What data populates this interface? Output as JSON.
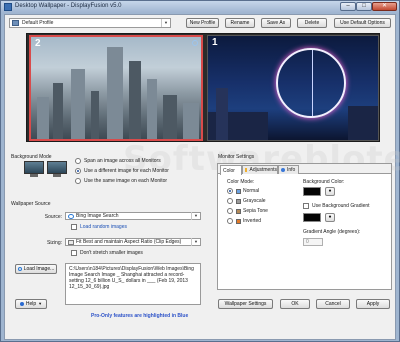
{
  "window": {
    "title": "Desktop Wallpaper - DisplayFusion v5.0"
  },
  "toolbar": {
    "profile_value": "Default Profile",
    "buttons": [
      "New Profile",
      "Rename",
      "Save As",
      "Delete",
      "Use Default Options"
    ]
  },
  "preview": {
    "monitor_numbers": [
      "2",
      "1"
    ]
  },
  "background_mode": {
    "heading": "Background Mode",
    "options": [
      {
        "label": "Span an image across all Monitors",
        "selected": false
      },
      {
        "label": "Use a different image for each Monitor",
        "selected": true
      },
      {
        "label": "Use the same image on each Monitor",
        "selected": false
      }
    ]
  },
  "wallpaper_source": {
    "heading": "Wallpaper Source",
    "source_label": "Source:",
    "source_value": "Bing Image Search",
    "load_random": "Load random images",
    "sizing_label": "Sizing:",
    "sizing_value": "Fit Best and maintain Aspect Ratio (Clip Edges)",
    "dont_stretch": "Don't stretch smaller images",
    "load_image_button": "Load Image...",
    "path_text": "C:\\Users\\n184\\Pictures\\DisplayFusion\\Web Images\\Bing Image Search Image _ Shanghai attracted a record-setting 12_6 billion U_S_ dollars in ___ (Feb 19, 2013 12_15_30_69).jpg"
  },
  "monitor_settings": {
    "heading": "Monitor Settings",
    "tabs": [
      "Color",
      "Adjustments",
      "Info"
    ],
    "color_mode_label": "Color Mode:",
    "color_modes": [
      {
        "label": "Normal",
        "selected": true
      },
      {
        "label": "Grayscale",
        "selected": false
      },
      {
        "label": "Sepia Tone",
        "selected": false
      },
      {
        "label": "Inverted",
        "selected": false
      }
    ],
    "background_color_label": "Background Color:",
    "use_gradient_label": "Use Background Gradient",
    "gradient_angle_label": "Gradient Angle (degrees):",
    "gradient_angle_value": "0",
    "background_color": "#050505"
  },
  "footer": {
    "help_label": "Help",
    "promo_text": "Pro-Only features are highlighted in Blue",
    "buttons": [
      "Wallpaper Settings",
      "OK",
      "Cancel",
      "Apply"
    ]
  },
  "watermark_text": "Softwareblotel",
  "colors": {
    "accent_link": "#1a4fb5",
    "promo": "#2c52c8",
    "selected_monitor_border": "#d94b4b"
  }
}
